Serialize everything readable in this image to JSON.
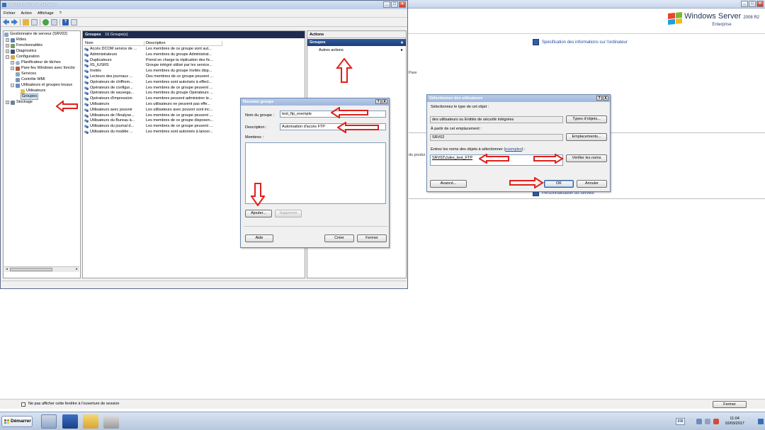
{
  "background_window": {
    "logo": {
      "brand": "Windows Server",
      "version": "2008 R2",
      "edition": "Enterprise"
    },
    "link_spec": "Spécification des informations sur l'ordinateur",
    "frag_pane": "Pare",
    "frag_product": "du produi",
    "link_personalize": "Personnalisation du serveur",
    "checkbox_label": "Ne pas afficher cette fenêtre à l'ouverture de session",
    "close_button": "Fermer"
  },
  "server_manager": {
    "title": "Gestionnaire de serveur",
    "menu": [
      "Fichier",
      "Action",
      "Affichage",
      "?"
    ],
    "tree": {
      "root": "Gestionnaire de serveur (SRV02)",
      "roles": "Rôles",
      "features": "Fonctionnalités",
      "diagnostics": "Diagnostics",
      "configuration": "Configuration",
      "task_scheduler": "Planificateur de tâches",
      "firewall": "Pare-feu Windows avec fonctio",
      "services": "Services",
      "wmi": "Contrôle WMI",
      "local_users": "Utilisateurs et groupes locaux",
      "users": "Utilisateurs",
      "groups": "Groupes",
      "storage": "Stockage"
    },
    "groups_panel": {
      "title": "Groupes",
      "count": "16 Groupe(s)",
      "col_name": "Nom",
      "col_desc": "Description",
      "rows": [
        {
          "name": "Accès DCOM service de ...",
          "desc": "Les membres de ce groupe sont aut..."
        },
        {
          "name": "Administrateurs",
          "desc": "Les membres du groupe Administrat..."
        },
        {
          "name": "Duplicateurs",
          "desc": "Prend en charge la réplication des fic..."
        },
        {
          "name": "IIS_IUSRS",
          "desc": "Groupe intégré utilisé par les service..."
        },
        {
          "name": "Invités",
          "desc": "Les membres du groupe Invités disp..."
        },
        {
          "name": "Lecteurs des journaux ...",
          "desc": "Des membres de ce groupe peuvent ..."
        },
        {
          "name": "Opérateurs de chiffrem...",
          "desc": "Les membres sont autorisés à effect..."
        },
        {
          "name": "Opérateurs de configur...",
          "desc": "Les membres de ce groupe peuvent ..."
        },
        {
          "name": "Opérateurs de sauvega...",
          "desc": "Les membres du groupe Opérateurs ..."
        },
        {
          "name": "Opérateurs d'impression",
          "desc": "Les membres peuvent administrer le..."
        },
        {
          "name": "Utilisateurs",
          "desc": "Les utilisateurs ne peuvent pas effe..."
        },
        {
          "name": "Utilisateurs avec pouvoir",
          "desc": "Les utilisateurs avec pouvoir sont inc..."
        },
        {
          "name": "Utilisateurs de l'Analyse...",
          "desc": "Les membres de ce groupe peuvent ..."
        },
        {
          "name": "Utilisateurs du Bureau à...",
          "desc": "Les membres de ce groupe disposen..."
        },
        {
          "name": "Utilisateurs du journal d...",
          "desc": "Les membres de ce groupe peuvent ..."
        },
        {
          "name": "Utilisateurs du modèle ...",
          "desc": "Les membres sont autorisés à lancer..."
        }
      ]
    },
    "actions": {
      "title": "Actions",
      "section": "Groupes",
      "item": "Autres actions"
    }
  },
  "new_group_dialog": {
    "title": "Nouveau groupe",
    "help": "?",
    "close": "X",
    "name_label": "Nom du groupe :",
    "name_value": "test_ftp_exemple",
    "desc_label": "Description :",
    "desc_value": "Autorisation d'accès FTP",
    "members_label": "Membres :",
    "add_button": "Ajouter...",
    "remove_button": "Supprimer",
    "help_button": "Aide",
    "create_button": "Créer",
    "close_button": "Fermer"
  },
  "select_users_dialog": {
    "title": "Sélectionnez des utilisateurs",
    "help": "?",
    "close": "X",
    "type_label": "Sélectionnez le type de cet objet :",
    "type_value": "des utilisateurs ou Entités de sécurité intégrées",
    "types_button": "Types d'objets...",
    "location_label": "À partir de cet emplacement :",
    "location_value": "SRV02",
    "locations_button": "Emplacements...",
    "names_label": "Entrez les noms des objets à sélectionner (",
    "names_link": "exemples",
    "names_label_end": ") :",
    "names_value": "SRV02\\Jules_test_FTP",
    "check_button": "Vérifier les noms",
    "advanced_button": "Avancé...",
    "ok_button": "OK",
    "cancel_button": "Annuler"
  },
  "taskbar": {
    "start": "Démarrer",
    "lang": "FR",
    "time": "11:04",
    "date": "10/03/2017"
  },
  "colors": {
    "annotation_red": "#e0201b",
    "header_navy": "#1f2c4f",
    "actions_blue": "#2d5aa0"
  }
}
